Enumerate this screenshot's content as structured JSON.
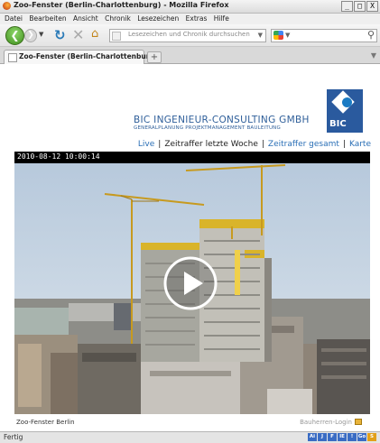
{
  "window": {
    "title": "Zoo-Fenster (Berlin-Charlottenburg) - Mozilla Firefox",
    "buttons": [
      "_",
      "□",
      "X"
    ]
  },
  "menu": [
    "Datei",
    "Bearbeiten",
    "Ansicht",
    "Chronik",
    "Lesezeichen",
    "Extras",
    "Hilfe"
  ],
  "nav": {
    "url_placeholder": "Lesezeichen und Chronik durchsuchen"
  },
  "tab": {
    "label": "Zoo-Fenster (Berlin-Charlottenburg)",
    "new_tab": "+"
  },
  "page": {
    "company": "BIC INGENIEUR-CONSULTING GMBH",
    "company_sub": "GENERALPLANUNG PROJEKTMANAGEMENT BAULEITUNG",
    "logo_text": "BIC",
    "links": [
      {
        "label": "Live",
        "current": false
      },
      {
        "label": "Zeitraffer letzte Woche",
        "current": true
      },
      {
        "label": "Zeitraffer gesamt",
        "current": false
      },
      {
        "label": "Karte",
        "current": false
      }
    ],
    "timestamp": "2010-08-12 10:00:14",
    "caption": "Zoo-Fenster Berlin",
    "login": "Bauherren-Login"
  },
  "status": {
    "text": "Fertig",
    "addons": [
      "Ai",
      "J",
      "F",
      "IE",
      "!",
      "Go",
      "S"
    ]
  },
  "colors": {
    "brand_blue": "#2a5a9e",
    "link": "#2a6fb6",
    "sky": "#c9d7e6"
  }
}
